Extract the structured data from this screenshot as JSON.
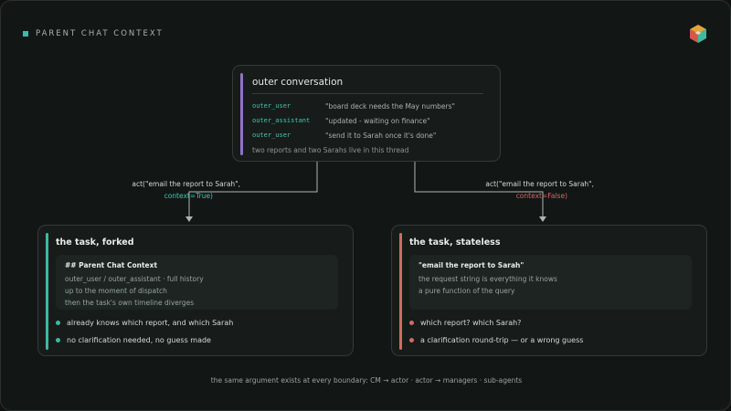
{
  "header": {
    "title": "PARENT CHAT CONTEXT"
  },
  "outer": {
    "title": "outer conversation",
    "rows": [
      {
        "role": "outer_user",
        "text": "\"board deck needs the May numbers\""
      },
      {
        "role": "outer_assistant",
        "text": "\"updated - waiting on finance\""
      },
      {
        "role": "outer_user",
        "text": "\"send it to Sarah once it's done\""
      }
    ],
    "note": "two reports and two Sarahs live in this thread"
  },
  "left_call": {
    "line1": "act(\"email the report to Sarah\",",
    "ctx": "context=True)"
  },
  "right_call": {
    "line1": "act(\"email the report to Sarah\",",
    "ctx": "context=False)"
  },
  "forked": {
    "title": "the task, forked",
    "inner_head": "## Parent Chat Context",
    "inner_lines": [
      "outer_user / outer_assistant · full history",
      "up to the moment of dispatch",
      "then the task's own timeline diverges"
    ],
    "bullets": [
      "already knows which report, and which Sarah",
      "no clarification needed, no guess made"
    ]
  },
  "stateless": {
    "title": "the task, stateless",
    "inner_head": "\"email the report to Sarah\"",
    "inner_lines": [
      "the request string is everything it knows",
      "a pure function of the query"
    ],
    "bullets": [
      "which report? which Sarah?",
      "a clarification round-trip — or a wrong guess"
    ]
  },
  "footer": "the same argument exists at every boundary: CM → actor · actor → managers · sub-agents",
  "colors": {
    "teal": "#3fb8a4",
    "red": "#d26a68",
    "purple": "#8f72c9"
  }
}
